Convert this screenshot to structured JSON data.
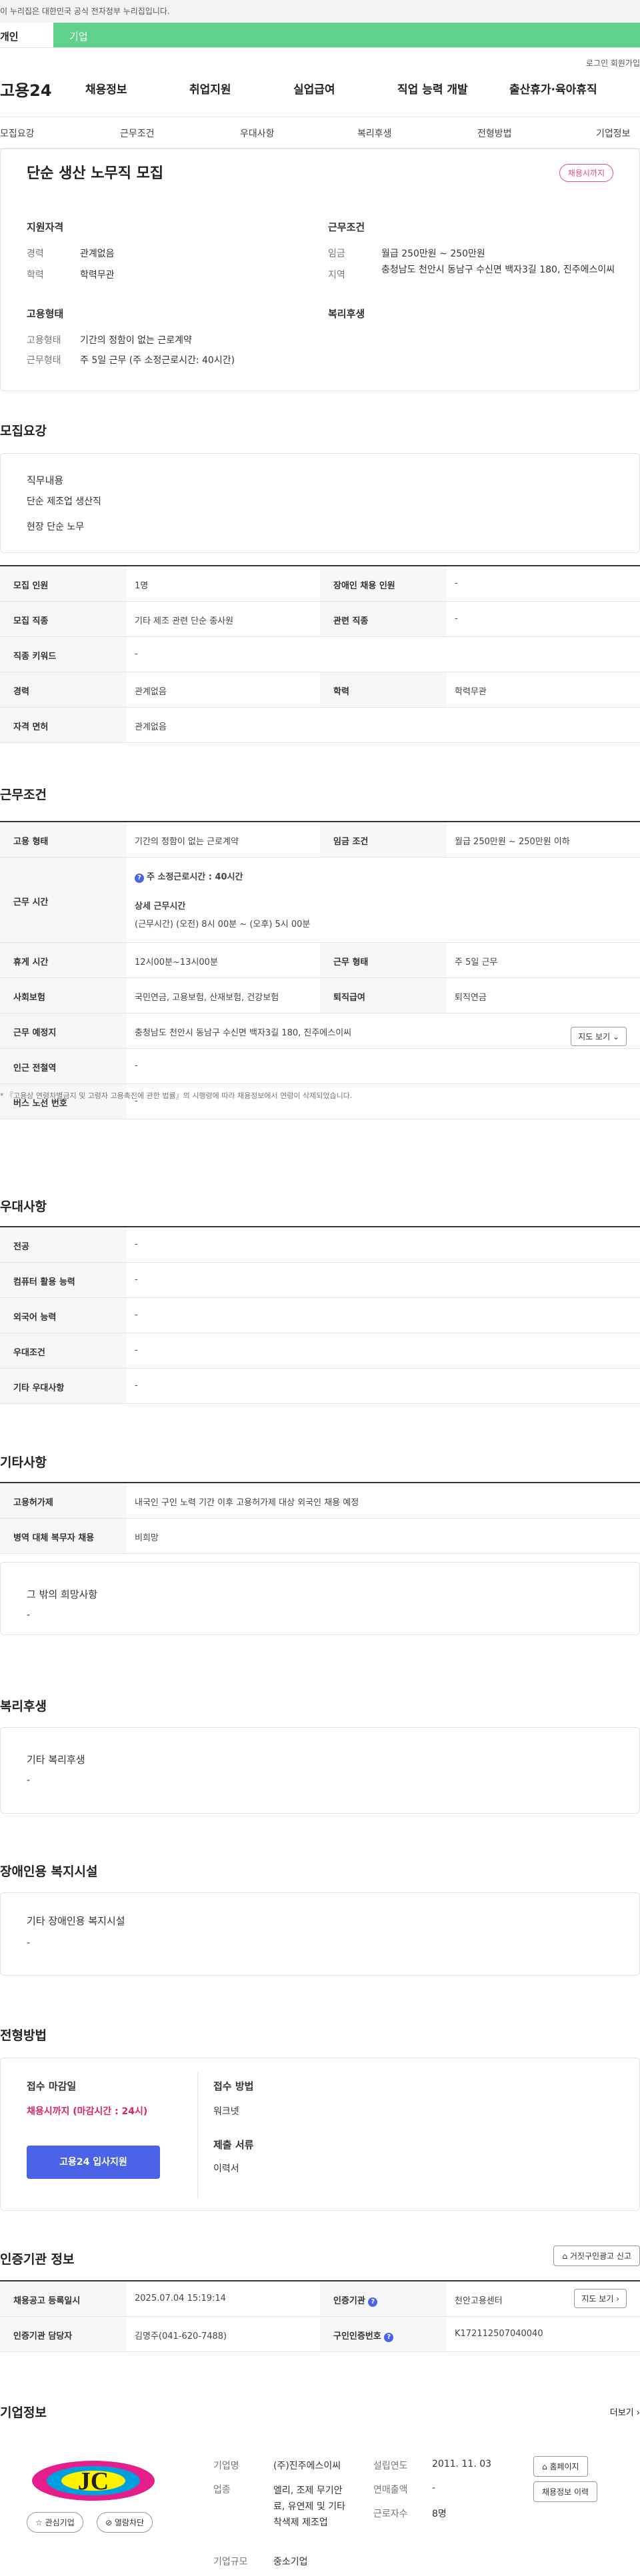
{
  "gov_bar": {
    "text": "이 누리집은 대한민국 공식 전자정부 누리집입니다."
  },
  "user_tabs": {
    "personal": "개인",
    "company": "기업"
  },
  "utility": {
    "login": "로그인",
    "join": "회원가입"
  },
  "gnb": {
    "logo": "고용24",
    "menu": [
      "채용정보",
      "취업지원",
      "실업급여",
      "직업 능력 개발",
      "출산휴가·육아휴직"
    ]
  },
  "snb": [
    "모집요강",
    "근무조건",
    "우대사항",
    "복리후생",
    "전형방법",
    "기업정보"
  ],
  "job": {
    "title": "단순 생산 노무직 모집",
    "status_badge": "채용시까지"
  },
  "summary": {
    "qual_title": "지원자격",
    "career_label": "경력",
    "career_value": "관계없음",
    "edu_label": "학력",
    "edu_value": "학력무관",
    "cond_title": "근무조건",
    "wage_label": "임금",
    "wage_value": "월급 250만원 ~ 250만원",
    "region_label": "지역",
    "region_value": "충청남도 천안시 동남구 수신면 백자3길 180, 진주에스이씨",
    "emp_title": "고용형태",
    "emp_type_label": "고용형태",
    "emp_type_value": "기간의 정함이 없는 근로계약",
    "work_type_label": "근무형태",
    "work_type_value": "주 5일 근무 (주 소정근로시간: 40시간)",
    "welfare_title": "복리후생"
  },
  "recruit": {
    "section_title": "모집요강",
    "duty_title": "직무내용",
    "duty_lines": [
      "단순 제조업 생산직",
      "현장 단순 노무"
    ],
    "table": {
      "headcount_label": "모집 인원",
      "headcount_value": "1명",
      "disabled_label": "장애인 채용 인원",
      "disabled_value": "-",
      "job_label": "모집 직종",
      "job_value": "기타 제조 관련 단순 종사원",
      "related_label": "관련 직종",
      "related_value": "-",
      "keyword_label": "직종 키워드",
      "keyword_value": "-",
      "career_label": "경력",
      "career_value": "관계없음",
      "edu_label": "학력",
      "edu_value": "학력무관",
      "license_label": "자격 면허",
      "license_value": "관계없음"
    }
  },
  "conditions": {
    "section_title": "근무조건",
    "emp_label": "고용 형태",
    "emp_value": "기간의 정함이 없는 근로계약",
    "wage_label": "임금 조건",
    "wage_value": "월급 250만원 ~ 250만원 이하",
    "hours_label": "근무 시간",
    "hours_weekly": "주 소정근로시간 : 40시간",
    "hours_detail_title": "상세 근무시간",
    "hours_detail": "(근무시간) (오전) 8시 00분 ~ (오후) 5시 00분",
    "break_label": "휴게 시간",
    "break_value": "12시00분~13시00분",
    "worktype_label": "근무 형태",
    "worktype_value": "주 5일 근무",
    "insurance_label": "사회보험",
    "insurance_value": "국민연금, 고용보험, 산재보험, 건강보험",
    "retire_label": "퇴직급여",
    "retire_value": "퇴직연금",
    "place_label": "근무 예정지",
    "place_value": "충청남도 천안시 동남구 수신면 백자3길 180, 진주에스이씨",
    "map_button": "지도 보기",
    "subway_label": "인근 전철역",
    "subway_value": "-",
    "bus_label": "버스 노선 번호",
    "bus_value": "-",
    "note": "* 『고용상 연령차별금지 및 고령자 고용촉진에 관한 법률』의 시행령에 따라 채용정보에서 연령이 삭제되었습니다."
  },
  "preference": {
    "section_title": "우대사항",
    "major_label": "전공",
    "major_value": "-",
    "computer_label": "컴퓨터 활용 능력",
    "computer_value": "-",
    "language_label": "외국어 능력",
    "language_value": "-",
    "pref_label": "우대조건",
    "pref_value": "-",
    "other_label": "기타 우대사항",
    "other_value": "-"
  },
  "etc": {
    "section_title": "기타사항",
    "permit_label": "고용허가제",
    "permit_value": "내국인 구인 노력 기간 이후 고용허가제 대상 외국인 채용 예정",
    "military_label": "병역 대체 복무자 채용",
    "military_value": "비희망",
    "other_title": "그 밖의 희망사항",
    "other_value": "-"
  },
  "welfare": {
    "section_title": "복리후생",
    "other_title": "기타 복리후생",
    "other_value": "-"
  },
  "disabled_welfare": {
    "section_title": "장애인용 복지시설",
    "other_title": "기타 장애인용 복지시설",
    "other_value": "-"
  },
  "selection": {
    "section_title": "전형방법",
    "deadline_title": "접수 마감일",
    "deadline_value": "채용시까지 (마감시간 : 24시)",
    "method_title": "접수 방법",
    "method_value": "워크넷",
    "docs_title": "제출 서류",
    "docs_value": "이력서",
    "apply_button": "고용24 입사지원"
  },
  "cert": {
    "section_title": "인증기관 정보",
    "report_button": "거짓구인광고 신고",
    "reg_label": "채용공고 등록일시",
    "reg_value": "2025.07.04 15:19:14",
    "agency_label": "인증기관",
    "agency_value": "천안고용센터",
    "map_button": "지도 보기",
    "manager_label": "인증기관 담당자",
    "manager_value": "김명주(041-620-7488)",
    "cert_no_label": "구인인증번호",
    "cert_no_value": "K172112507040040"
  },
  "company": {
    "section_title": "기업정보",
    "more": "더보기",
    "logo_text": "JC",
    "interest_button": "관심기업",
    "block_button": "열람차단",
    "name_label": "기업명",
    "name_value": "(주)진주에스이씨",
    "industry_label": "업종",
    "industry_value": "엘리, 조제 무기안료, 유연제 및 기타 착색제 제조업",
    "size_label": "기업규모",
    "size_value": "중소기업",
    "founded_label": "설립연도",
    "founded_value": "2011. 11. 03",
    "sales_label": "연매출액",
    "sales_value": "-",
    "employees_label": "근로자수",
    "employees_value": "8명",
    "homepage_button": "홈페이지",
    "history_button": "채용정보 이력"
  }
}
